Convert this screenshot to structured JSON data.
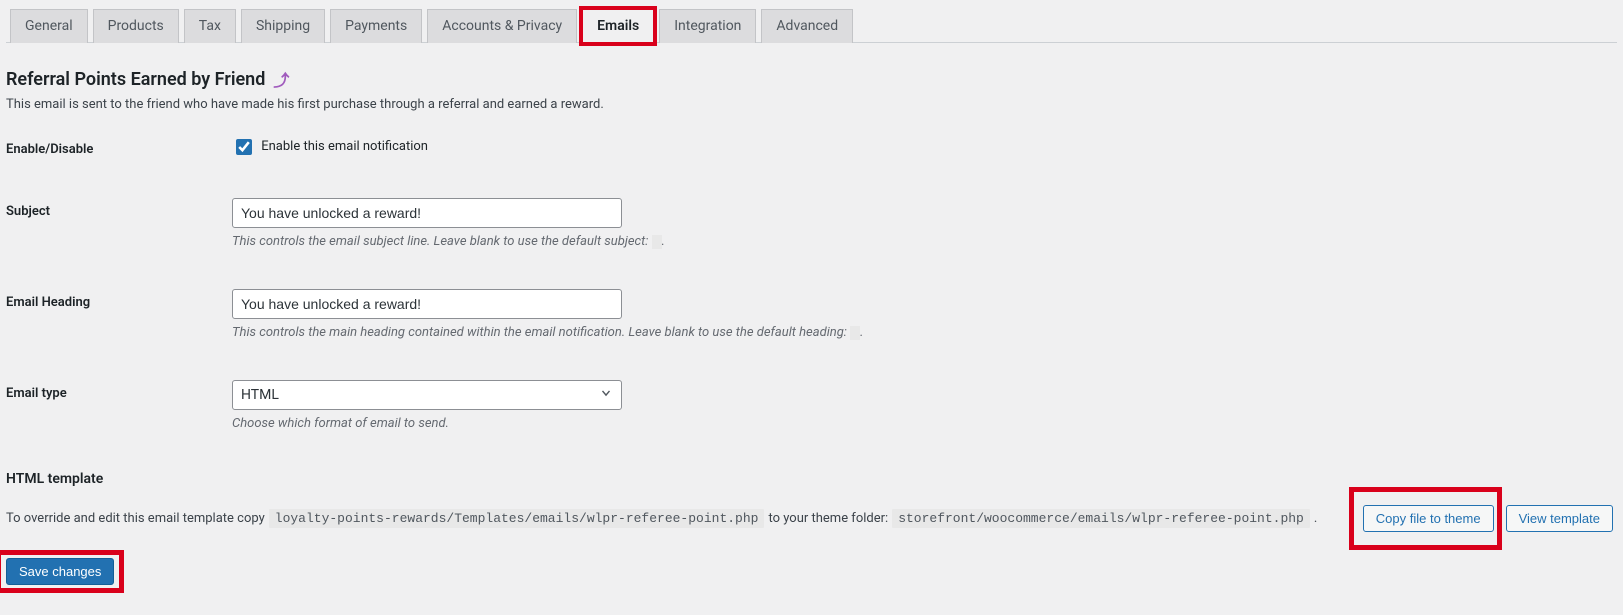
{
  "tabs": [
    {
      "label": "General"
    },
    {
      "label": "Products"
    },
    {
      "label": "Tax"
    },
    {
      "label": "Shipping"
    },
    {
      "label": "Payments"
    },
    {
      "label": "Accounts & Privacy"
    },
    {
      "label": "Emails",
      "active": true,
      "highlight": true
    },
    {
      "label": "Integration"
    },
    {
      "label": "Advanced"
    }
  ],
  "page": {
    "title": "Referral Points Earned by Friend",
    "description": "This email is sent to the friend who have made his first purchase through a referral and earned a reward."
  },
  "form": {
    "enable_disable": {
      "label": "Enable/Disable",
      "checkbox_label": "Enable this email notification",
      "checked": true
    },
    "subject": {
      "label": "Subject",
      "value": "You have unlocked a reward!",
      "help": "This controls the email subject line. Leave blank to use the default subject:",
      "help_tail": "."
    },
    "heading": {
      "label": "Email Heading",
      "value": "You have unlocked a reward!",
      "help": "This controls the main heading contained within the email notification. Leave blank to use the default heading:",
      "help_tail": "."
    },
    "email_type": {
      "label": "Email type",
      "value": "HTML",
      "help": "Choose which format of email to send."
    }
  },
  "template": {
    "title": "HTML template",
    "text_before": "To override and edit this email template copy",
    "code1": "loyalty-points-rewards/Templates/emails/wlpr-referee-point.php",
    "text_mid": "to your theme folder:",
    "code2": "storefront/woocommerce/emails/wlpr-referee-point.php",
    "text_after": ".",
    "copy_btn": "Copy file to theme",
    "view_btn": "View template"
  },
  "save_btn": "Save changes"
}
